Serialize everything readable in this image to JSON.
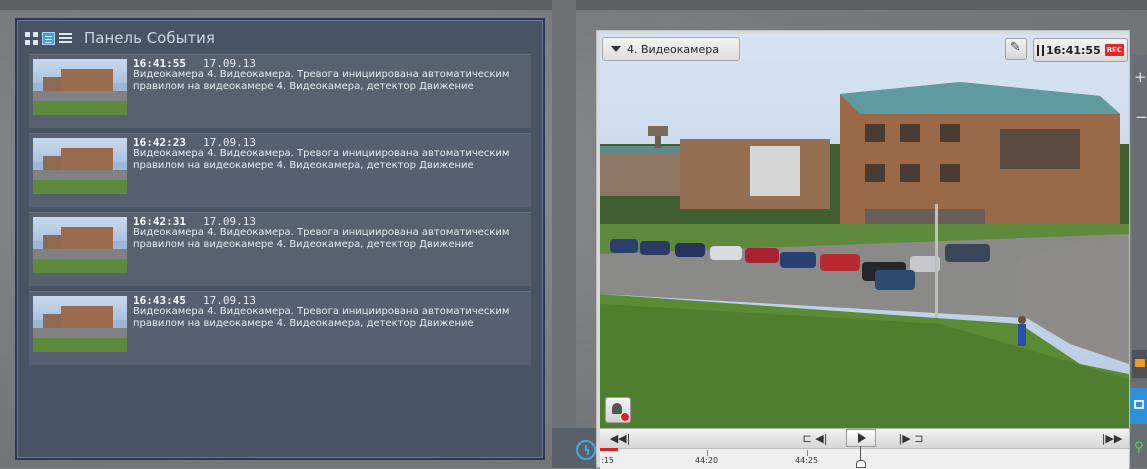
{
  "event_panel": {
    "title": "Панель События",
    "events": [
      {
        "time": "16:41:55",
        "date": "17.09.13",
        "text": "Видеокамера 4. Видеокамера. Тревога инициирована автоматическим правилом на видеокамере 4. Видеокамера, детектор Движение"
      },
      {
        "time": "16:42:23",
        "date": "17.09.13",
        "text": "Видеокамера 4. Видеокамера. Тревога инициирована автоматическим правилом на видеокамере 4. Видеокамера, детектор Движение"
      },
      {
        "time": "16:42:31",
        "date": "17.09.13",
        "text": "Видеокамера 4. Видеокамера. Тревога инициирована автоматическим правилом на видеокамере 4. Видеокамера, детектор Движение"
      },
      {
        "time": "16:43:45",
        "date": "17.09.13",
        "text": "Видеокамера 4. Видеокамера. Тревога инициирована автоматическим правилом на видеокамере 4. Видеокамера, детектор Движение"
      }
    ]
  },
  "camera": {
    "title": "4. Видеокамера",
    "clock": "16:41:55",
    "rec_label": "REC"
  },
  "playback": {
    "rewind_label": "◀◀|",
    "frame_back_label": "⊏  ◀|",
    "frame_fwd_label": "|▶  ⊐",
    "forward_label": "|▶▶"
  },
  "timeline": {
    "labels": [
      ":15",
      "44:20",
      "44:25"
    ]
  },
  "icons": {
    "view_grid": "grid-icon",
    "view_list_images": "list-with-images-icon",
    "view_list": "list-icon",
    "camera_dropdown": "chevron-down-icon",
    "edit": "pencil-icon",
    "pause": "pause-icon",
    "alarm": "alarm-bell-icon",
    "archive_clock": "clock-icon",
    "zoom_in": "plus-icon",
    "zoom_out": "minus-icon",
    "search": "search-icon"
  },
  "colors": {
    "panel_bg": "#485464",
    "panel_border": "#2b3a52",
    "accent_blue": "#3aa0e8",
    "rec_red": "#e32626"
  }
}
